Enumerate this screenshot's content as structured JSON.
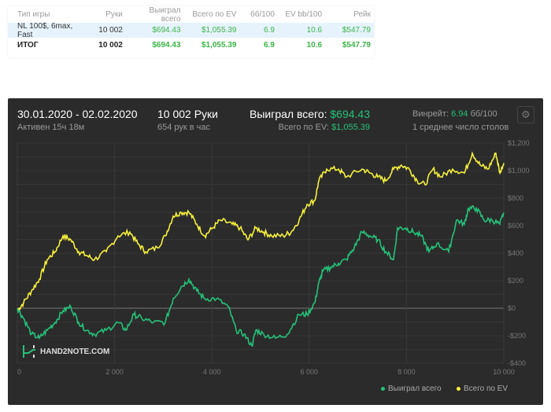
{
  "table": {
    "headers": [
      "Тип игры",
      "Руки",
      "Выиграл всего",
      "Всего по EV",
      "бб/100",
      "EV bb/100",
      "Рейк"
    ],
    "rows": [
      [
        "NL 100$, 6max, Fast",
        "10 002",
        "$694.43",
        "$1,055.39",
        "6.9",
        "10.6",
        "$547.79"
      ]
    ],
    "total": [
      "ИТОГ",
      "10 002",
      "$694.43",
      "$1,055.39",
      "6.9",
      "10.6",
      "$547.79"
    ]
  },
  "summary": {
    "date_range": "30.01.2020 - 02.02.2020",
    "active": "Активен 15ч 18м",
    "hands": "10 002 Руки",
    "hands_per_hour": "654 рук в час",
    "won_label": "Выиграл всего:",
    "won_value": "$694.43",
    "ev_label": "Всего по EV:",
    "ev_value": "$1,055.39",
    "winrate_label": "Винрейт:",
    "winrate_value": "6.94",
    "winrate_unit": "бб/100",
    "tables": "1 среднее число столов",
    "settings_icon": "gear-icon"
  },
  "watermark": "HAND2NOTE.COM",
  "colors": {
    "won": "#25c17a",
    "ev": "#f5f03c",
    "panel": "#2b2b2b"
  },
  "chart_data": {
    "type": "line",
    "xlim": [
      0,
      10000
    ],
    "ylim": [
      -400,
      1200
    ],
    "xticks": [
      0,
      2000,
      4000,
      6000,
      8000,
      10000
    ],
    "xtick_labels": [
      "0",
      "2 000",
      "4 000",
      "6 000",
      "8 000",
      "10 000"
    ],
    "yticks": [
      1200,
      1000,
      800,
      600,
      400,
      200,
      0,
      -200,
      -400
    ],
    "ytick_labels": [
      "$1,200",
      "$1,000",
      "$800",
      "$600",
      "$400",
      "$200",
      "$0",
      "-$200",
      "-$400"
    ],
    "legend": [
      "Выиграл всего",
      "Всего по EV"
    ],
    "legend_position": "bottom-right",
    "series": [
      {
        "name": "Выиграл всего",
        "color": "#25c17a",
        "points": [
          [
            0,
            0
          ],
          [
            129,
            -74
          ],
          [
            291,
            -189
          ],
          [
            453,
            -217
          ],
          [
            615,
            -160
          ],
          [
            777,
            -103
          ],
          [
            939,
            -17
          ],
          [
            1100,
            11
          ],
          [
            1262,
            -103
          ],
          [
            1424,
            -160
          ],
          [
            1586,
            -189
          ],
          [
            1828,
            -160
          ],
          [
            2071,
            -103
          ],
          [
            2233,
            -160
          ],
          [
            2395,
            -46
          ],
          [
            2557,
            -74
          ],
          [
            2799,
            -103
          ],
          [
            3042,
            -103
          ],
          [
            3204,
            69
          ],
          [
            3366,
            154
          ],
          [
            3528,
            211
          ],
          [
            3689,
            126
          ],
          [
            3851,
            69
          ],
          [
            4094,
            69
          ],
          [
            4337,
            11
          ],
          [
            4498,
            -160
          ],
          [
            4660,
            -189
          ],
          [
            4822,
            -274
          ],
          [
            4903,
            -160
          ],
          [
            5065,
            -189
          ],
          [
            5307,
            -217
          ],
          [
            5550,
            -189
          ],
          [
            5793,
            -46
          ],
          [
            5955,
            -46
          ],
          [
            6117,
            40
          ],
          [
            6197,
            183
          ],
          [
            6278,
            269
          ],
          [
            6440,
            297
          ],
          [
            6602,
            326
          ],
          [
            6764,
            354
          ],
          [
            6926,
            440
          ],
          [
            7087,
            554
          ],
          [
            7249,
            526
          ],
          [
            7411,
            497
          ],
          [
            7573,
            411
          ],
          [
            7735,
            354
          ],
          [
            7816,
            583
          ],
          [
            7977,
            583
          ],
          [
            8139,
            554
          ],
          [
            8301,
            526
          ],
          [
            8463,
            411
          ],
          [
            8625,
            469
          ],
          [
            8867,
            411
          ],
          [
            9029,
            640
          ],
          [
            9191,
            611
          ],
          [
            9272,
            726
          ],
          [
            9434,
            726
          ],
          [
            9595,
            640
          ],
          [
            9757,
            640
          ],
          [
            9919,
            611
          ],
          [
            10000,
            694
          ]
        ]
      },
      {
        "name": "Всего по EV",
        "color": "#f5f03c",
        "points": [
          [
            0,
            -17
          ],
          [
            129,
            40
          ],
          [
            291,
            126
          ],
          [
            453,
            211
          ],
          [
            615,
            354
          ],
          [
            777,
            411
          ],
          [
            939,
            526
          ],
          [
            1100,
            497
          ],
          [
            1262,
            411
          ],
          [
            1424,
            383
          ],
          [
            1586,
            354
          ],
          [
            1828,
            411
          ],
          [
            2071,
            526
          ],
          [
            2314,
            554
          ],
          [
            2476,
            469
          ],
          [
            2638,
            411
          ],
          [
            2880,
            440
          ],
          [
            3042,
            526
          ],
          [
            3204,
            669
          ],
          [
            3366,
            697
          ],
          [
            3528,
            697
          ],
          [
            3689,
            611
          ],
          [
            3851,
            526
          ],
          [
            4013,
            583
          ],
          [
            4175,
            640
          ],
          [
            4417,
            611
          ],
          [
            4579,
            583
          ],
          [
            4741,
            497
          ],
          [
            4903,
            583
          ],
          [
            5065,
            554
          ],
          [
            5227,
            526
          ],
          [
            5469,
            526
          ],
          [
            5631,
            554
          ],
          [
            5793,
            640
          ],
          [
            5955,
            754
          ],
          [
            6117,
            783
          ],
          [
            6197,
            926
          ],
          [
            6359,
            1011
          ],
          [
            6602,
            1011
          ],
          [
            6764,
            954
          ],
          [
            7087,
            1011
          ],
          [
            7249,
            983
          ],
          [
            7411,
            954
          ],
          [
            7573,
            926
          ],
          [
            7735,
            1011
          ],
          [
            7896,
            1040
          ],
          [
            8058,
            1011
          ],
          [
            8220,
            926
          ],
          [
            8382,
            897
          ],
          [
            8544,
            1011
          ],
          [
            8706,
            954
          ],
          [
            8948,
            1011
          ],
          [
            9191,
            983
          ],
          [
            9353,
            1126
          ],
          [
            9515,
            1040
          ],
          [
            9676,
            1011
          ],
          [
            9838,
            1126
          ],
          [
            9919,
            983
          ],
          [
            10000,
            1055
          ]
        ]
      }
    ]
  }
}
